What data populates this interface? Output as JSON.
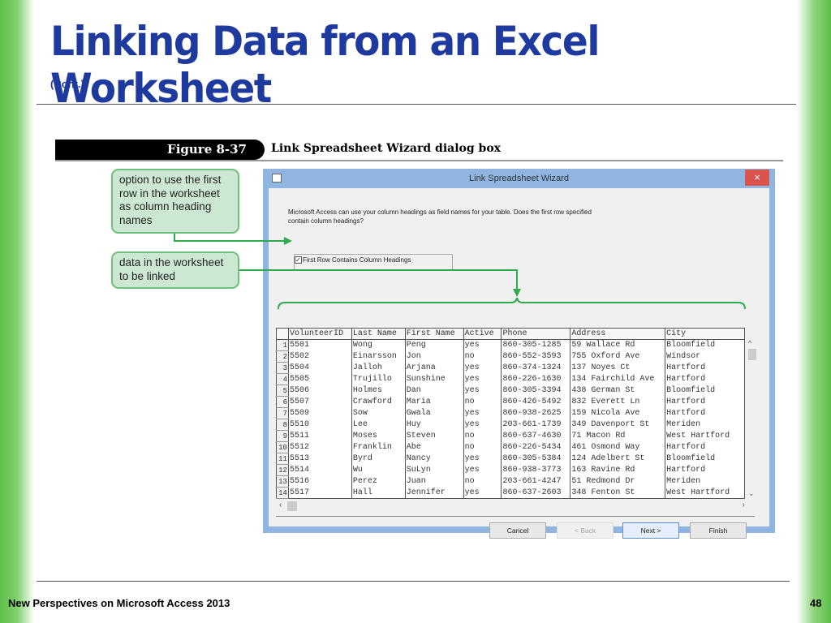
{
  "slide": {
    "title": "Linking Data from an Excel Worksheet",
    "subtitle": "(Cont.)",
    "footer": "New Perspectives on Microsoft Access 2013",
    "page": "48"
  },
  "figure": {
    "number": "Figure 8-37",
    "caption": "Link Spreadsheet Wizard dialog box"
  },
  "callouts": [
    "option to use the first row in the worksheet as column heading names",
    "data in the worksheet to be linked"
  ],
  "dialog": {
    "title": "Link Spreadsheet Wizard",
    "close": "×",
    "message": "Microsoft Access can use your column headings as field names for your table. Does the first row specified contain column headings?",
    "checkbox_label": "First Row Contains Column Headings",
    "checkbox_mark": "✓",
    "buttons": {
      "cancel": "Cancel",
      "back": "< Back",
      "next": "Next >",
      "finish": "Finish"
    }
  },
  "grid": {
    "columns": [
      "VolunteerID",
      "Last Name",
      "First Name",
      "Active",
      "Phone",
      "Address",
      "City"
    ],
    "rows": [
      [
        "5501",
        "Wong",
        "Peng",
        "yes",
        "860-305-1285",
        "59 Wallace Rd",
        "Bloomfield"
      ],
      [
        "5502",
        "Einarsson",
        "Jon",
        "no",
        "860-552-3593",
        "755 Oxford Ave",
        "Windsor"
      ],
      [
        "5504",
        "Jalloh",
        "Arjana",
        "yes",
        "860-374-1324",
        "137 Noyes Ct",
        "Hartford"
      ],
      [
        "5505",
        "Trujillo",
        "Sunshine",
        "yes",
        "860-226-1630",
        "134 Fairchild Ave",
        "Hartford"
      ],
      [
        "5506",
        "Holmes",
        "Dan",
        "yes",
        "860-305-3394",
        "438 German St",
        "Bloomfield"
      ],
      [
        "5507",
        "Crawford",
        "Maria",
        "no",
        "860-426-5492",
        "832 Everett Ln",
        "Hartford"
      ],
      [
        "5509",
        "Sow",
        "Gwala",
        "yes",
        "860-938-2625",
        "159 Nicola Ave",
        "Hartford"
      ],
      [
        "5510",
        "Lee",
        "Huy",
        "yes",
        "203-661-1739",
        "349 Davenport St",
        "Meriden"
      ],
      [
        "5511",
        "Moses",
        "Steven",
        "no",
        "860-637-4630",
        "71 Macon Rd",
        "West Hartford"
      ],
      [
        "5512",
        "Franklin",
        "Abe",
        "no",
        "860-226-5434",
        "461 Osmond Way",
        "Hartford"
      ],
      [
        "5513",
        "Byrd",
        "Nancy",
        "yes",
        "860-305-5384",
        "124 Adelbert St",
        "Bloomfield"
      ],
      [
        "5514",
        "Wu",
        "SuLyn",
        "yes",
        "860-938-3773",
        "163 Ravine Rd",
        "Hartford"
      ],
      [
        "5516",
        "Perez",
        "Juan",
        "no",
        "203-661-4247",
        "51 Redmond Dr",
        "Meriden"
      ],
      [
        "5517",
        "Hall",
        "Jennifer",
        "yes",
        "860-637-2603",
        "348 Fenton St",
        "West Hartford"
      ]
    ]
  },
  "colors": {
    "title": "#1f3a9e",
    "green": "#2eab4a",
    "dialog_frame": "#8fb5e0"
  }
}
